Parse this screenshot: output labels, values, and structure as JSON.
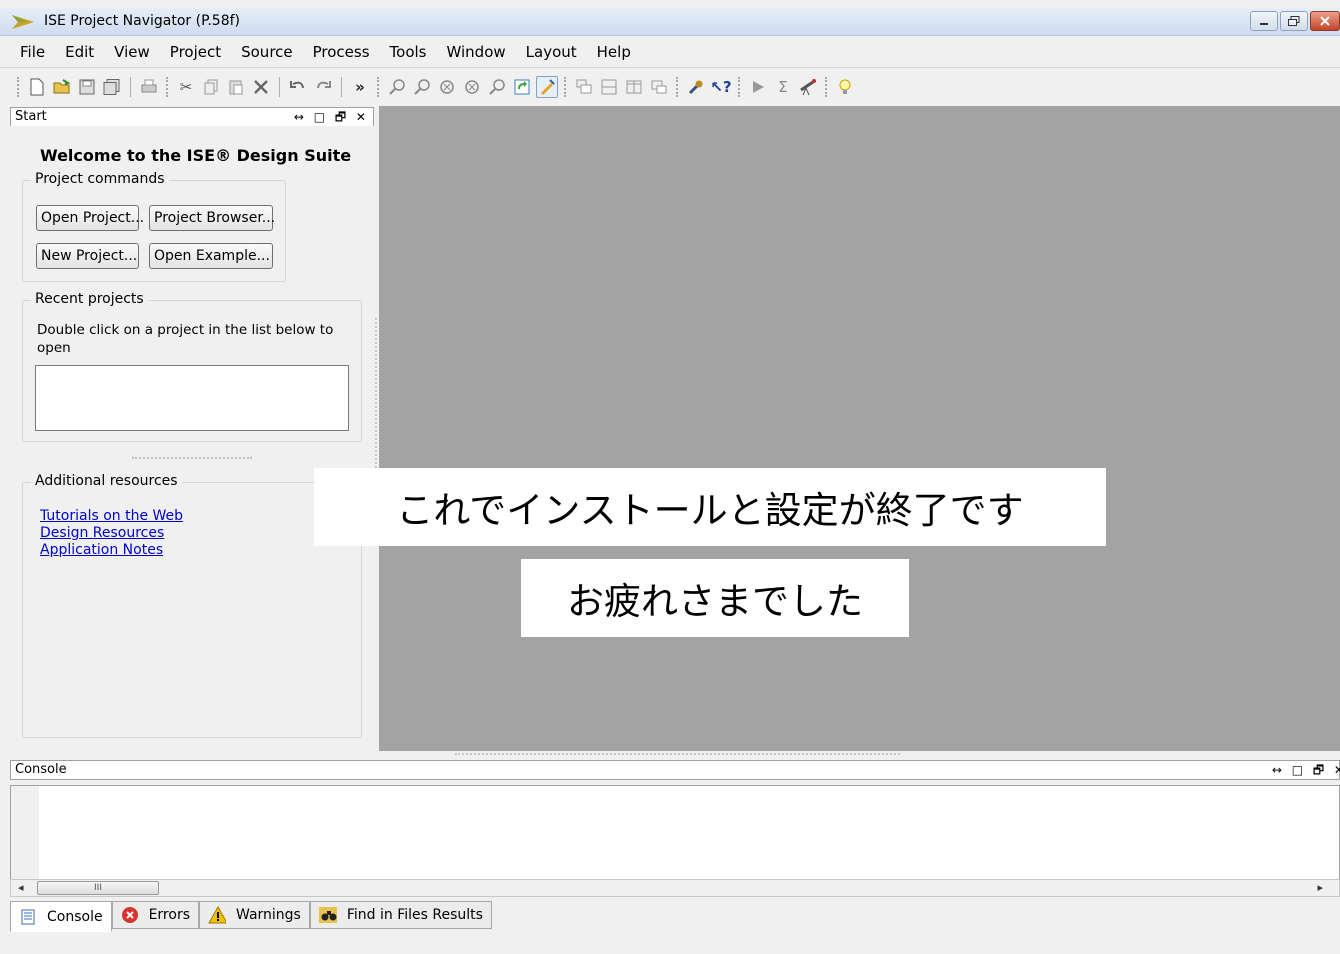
{
  "window": {
    "title": "ISE Project Navigator (P.58f)",
    "controls": [
      "minimize",
      "restore",
      "close"
    ]
  },
  "menubar": [
    "File",
    "Edit",
    "View",
    "Project",
    "Source",
    "Process",
    "Tools",
    "Window",
    "Layout",
    "Help"
  ],
  "toolbar": {
    "icons": [
      "new-file-icon",
      "open-folder-icon",
      "save-icon",
      "save-all-icon",
      "print-icon",
      "cut-icon",
      "copy-icon",
      "paste-icon",
      "delete-icon",
      "undo-icon",
      "redo-icon",
      "overflow-icon",
      "zoom-in-icon",
      "zoom-out-icon",
      "zoom-fit-icon",
      "zoom-fit-all-icon",
      "zoom-icon",
      "refresh-icon",
      "design-icon",
      "window-cascade-icon",
      "window-tile-horizontal-icon",
      "window-tile-vertical-icon",
      "window-float-icon",
      "properties-icon",
      "help-icon",
      "run-icon",
      "sum-icon",
      "telescope-icon",
      "lightbulb-icon"
    ],
    "overflow_label": "»"
  },
  "start_panel": {
    "header": "Start",
    "header_controls": "↔ □ 🗗 ✕",
    "welcome": "Welcome to the ISE® Design Suite",
    "project_commands": {
      "label": "Project commands",
      "open_project": "Open Project...",
      "project_browser": "Project Browser...",
      "new_project": "New Project...",
      "open_example": "Open Example..."
    },
    "recent_projects": {
      "label": "Recent projects",
      "hint": "Double click on a project in the list below to open"
    },
    "additional_resources": {
      "label": "Additional resources",
      "links": [
        "Tutorials on the Web",
        "Design Resources",
        "Application Notes"
      ]
    }
  },
  "overlay": {
    "line1": "これでインストールと設定が終了です",
    "line2": "お疲れさまでした"
  },
  "console": {
    "header": "Console",
    "header_controls": "↔ □ 🗗 ✕",
    "scroll_thumb": "III",
    "tabs": [
      {
        "label": "Console",
        "icon": "console-icon"
      },
      {
        "label": "Errors",
        "icon": "error-icon"
      },
      {
        "label": "Warnings",
        "icon": "warning-icon"
      },
      {
        "label": "Find in Files Results",
        "icon": "binoculars-icon"
      }
    ]
  },
  "colors": {
    "workarea": "#a3a3a3",
    "link": "#0000cc",
    "error": "#d9342b",
    "warning": "#f2c200"
  }
}
